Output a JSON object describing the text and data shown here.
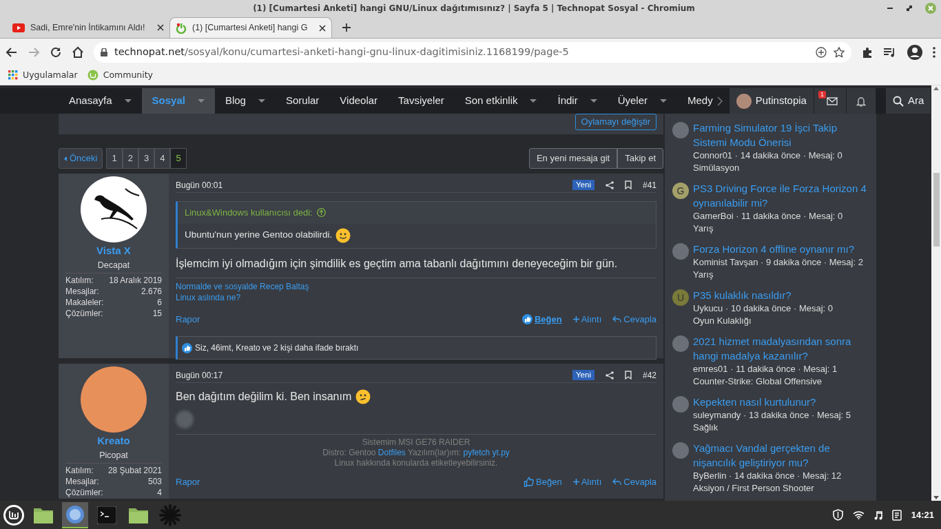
{
  "window": {
    "title": "(1) [Cumartesi Anketi] hangi GNU/Linux dağıtımısınız? | Sayfa 5 | Technopat Sosyal - Chromium"
  },
  "browser_tabs": [
    {
      "title": "Sadi, Emre'nin İntikamını Aldı!",
      "selected": false
    },
    {
      "title": "(1) [Cumartesi Anketi] hangi G",
      "selected": true
    }
  ],
  "toolbar": {
    "forward_disabled": true,
    "url_domain": "technopat.net",
    "url_path": "/sosyal/konu/cumartesi-anketi-hangi-gnu-linux-dagitimisiniz.1168199/page-5"
  },
  "bookmarks": [
    {
      "label": "Uygulamalar"
    },
    {
      "label": "Community"
    }
  ],
  "nav": {
    "items": [
      {
        "label": "Anasayfa",
        "selected": false,
        "menu": true
      },
      {
        "label": "Sosyal",
        "selected": true,
        "menu": true
      },
      {
        "label": "Blog",
        "selected": false,
        "menu": true
      },
      {
        "label": "Sorular",
        "selected": false,
        "menu": false
      },
      {
        "label": "Videolar",
        "selected": false,
        "menu": false
      },
      {
        "label": "Tavsiyeler",
        "selected": false,
        "menu": false
      },
      {
        "label": "Son etkinlik",
        "selected": false,
        "menu": true
      },
      {
        "label": "İndir",
        "selected": false,
        "menu": true
      },
      {
        "label": "Üyeler",
        "selected": false,
        "menu": true
      },
      {
        "label": "Medy",
        "selected": false,
        "menu": false
      }
    ],
    "user": "Putinstopia",
    "mail_badge": "1",
    "search": "Ara"
  },
  "poll": {
    "button": "Oylamayı değiştir"
  },
  "pagination": {
    "prev": "Önceki",
    "pages": [
      {
        "label": "1",
        "selected": false
      },
      {
        "label": "2",
        "selected": false
      },
      {
        "label": "3",
        "selected": false
      },
      {
        "label": "4",
        "selected": false
      },
      {
        "label": "5",
        "selected": true
      }
    ],
    "buttons": [
      "En yeni mesaja git",
      "Takip et"
    ]
  },
  "posts": [
    {
      "author": "Vista X",
      "rank": "Decapat",
      "stats": [
        {
          "label": "Katılım:",
          "value": "18 Aralık 2019"
        },
        {
          "label": "Mesajlar:",
          "value": "2.676"
        },
        {
          "label": "Makaleler:",
          "value": "6"
        },
        {
          "label": "Çözümler:",
          "value": "15"
        }
      ],
      "date": "Bugün 00:01",
      "badge": "Yeni",
      "number": "#41",
      "quote": {
        "author": "Linux&Windows kullanıcısı dedi:",
        "text": "Ubuntu'nun yerine Gentoo olabilirdi."
      },
      "body": "İşlemcim iyi olmadığım için şimdilik es geçtim ama tabanlı dağıtımını deneyeceğim bir gün.",
      "signature": [
        [
          {
            "text": "Normalde ve sosyalde Recep Baltaş",
            "link": true
          }
        ],
        [
          {
            "text": "Linux aslında ne?",
            "link": true
          }
        ]
      ],
      "actions": {
        "report": "Rapor",
        "like": "Beğen",
        "liked": true,
        "quote": "Alıntı",
        "reply": "Cevapla"
      },
      "reactions": "Siz, 46imt, Kreato ve 2 kişi daha ifade bıraktı"
    },
    {
      "author": "Kreato",
      "rank": "Picopat",
      "stats": [
        {
          "label": "Katılım:",
          "value": "28 Şubat 2021"
        },
        {
          "label": "Mesajlar:",
          "value": "503"
        },
        {
          "label": "Çözümler:",
          "value": "4"
        }
      ],
      "date": "Bugün 00:17",
      "badge": "Yeni",
      "number": "#42",
      "body": "Ben dağıtım değilim ki. Ben insanım",
      "image": true,
      "signature": [
        [
          {
            "text": "Sistemim MSI GE76 RAIDER",
            "link": false
          }
        ],
        [
          {
            "text": "Distro: Gentoo",
            "link": false
          },
          {
            "text": "Dotfiles",
            "link": true
          },
          {
            "text": "Yazılım(lar)ım:",
            "link": false
          },
          {
            "text": "pyfetch",
            "link": true
          },
          {
            "text": "yt.py",
            "link": true
          }
        ],
        [
          {
            "text": "Linux hakkında konularda etiketleyebilirsiniz.",
            "link": false
          }
        ]
      ],
      "actions": {
        "report": "Rapor",
        "like": "Beğen",
        "liked": false,
        "quote": "Alıntı",
        "reply": "Cevapla"
      }
    }
  ],
  "sidebar": {
    "threads": [
      {
        "title": "Farming Simulator 19 İşci Takip Sistemi Modu Önerisi",
        "meta": "Connor01 · 14 dakika önce · Mesaj: 0",
        "forum": "Simülasyon"
      },
      {
        "title": "PS3 Driving Force ile Forza Horizon 4 oynanılabilir mi?",
        "meta": "GamerBoi · 11 dakika önce · Mesaj: 0",
        "forum": "Yarış",
        "avatar_letter": "G",
        "color": "#a3a06a"
      },
      {
        "title": "Forza Horizon 4 offline oynanır mı?",
        "meta": "Kominist Tavşan · 9 dakika önce · Mesaj: 2",
        "forum": "Yarış"
      },
      {
        "title": "P35 kulaklık nasıldır?",
        "meta": "Uykucu · 10 dakika önce · Mesaj: 0",
        "forum": "Oyun Kulaklığı",
        "avatar_letter": "U",
        "color": "#7a7a3a"
      },
      {
        "title": "2021 hizmet madalyasından sonra hangi madalya kazanılır?",
        "meta": "emres01 · 11 dakika önce · Mesaj: 1",
        "forum": "Counter-Strike: Global Offensive"
      },
      {
        "title": "Kepekten nasıl kurtulunur?",
        "meta": "suleymandy · 13 dakika önce · Mesaj: 5",
        "forum": "Sağlık"
      },
      {
        "title": "Yağmacı Vandal gerçekten de nişancılık geliştiriyor mu?",
        "meta": "ByBerlin · 14 dakika önce · Mesaj: 12",
        "forum": "Aksiyon / First Person Shooter"
      }
    ]
  },
  "taskbar": {
    "apps": [
      {
        "active": false
      },
      {
        "active": true
      },
      {
        "active": false
      },
      {
        "active": false
      },
      {
        "active": false
      }
    ],
    "clock": "14:21"
  }
}
